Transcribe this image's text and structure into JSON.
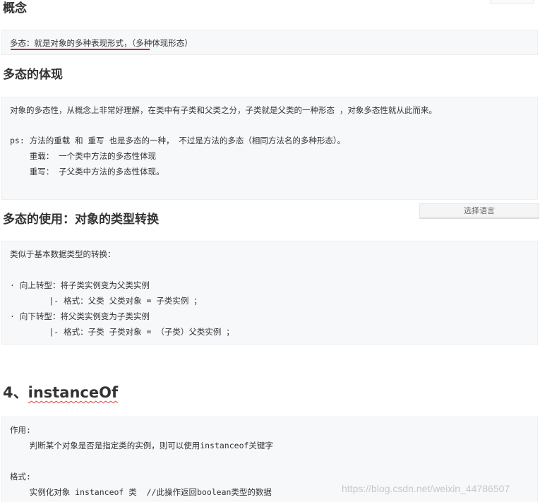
{
  "sections": {
    "concept": {
      "heading": "概念",
      "lines": [
        "多态：就是对象的多种表现形式，（多种体现形态）"
      ]
    },
    "embodiment": {
      "heading": "多态的体现",
      "lines": [
        "对象的多态性，从概念上非常好理解，在类中有子类和父类之分，子类就是父类的一种形态 ，对象多态性就从此而来。",
        "ps: 方法的重载 和 重写 也是多态的一种， 不过是方法的多态（相同方法名的多种形态）。",
        "    重载： 一个类中方法的多态性体现",
        "    重写： 子父类中方法的多态性体现。"
      ]
    },
    "usage": {
      "heading": "多态的使用：对象的类型转换",
      "lines": [
        "类似于基本数据类型的转换：",
        "· 向上转型：将子类实例变为父类实例",
        "        |- 格式：父类 父类对象 = 子类实例 ；",
        "· 向下转型：将父类实例变为子类实例",
        "        |- 格式：子类 子类对象 = （子类）父类实例 ；"
      ]
    },
    "instanceof": {
      "heading_num": "4、",
      "heading_word": "instanceOf",
      "lines": [
        "作用:",
        "    判断某个对象是否是指定类的实例，则可以使用instanceof关键字",
        "格式:",
        "    实例化对象 instanceof 类  //此操作返回boolean类型的数据"
      ]
    }
  },
  "language_select": {
    "label": "选择语言"
  },
  "watermark": "https://blog.csdn.net/weixin_44786507",
  "colors": {
    "code_background": "#f6f8fa",
    "heading_text": "#333333",
    "underline_red": "#e02020",
    "watermark": "#c8c8c8"
  }
}
